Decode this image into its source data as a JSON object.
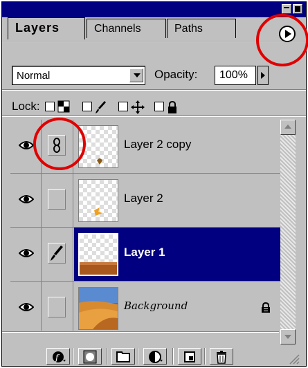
{
  "tabs": [
    {
      "label": "Layers",
      "active": true
    },
    {
      "label": "Channels",
      "active": false
    },
    {
      "label": "Paths",
      "active": false
    }
  ],
  "blend_mode": "Normal",
  "opacity": {
    "label": "Opacity:",
    "value": "100%"
  },
  "lock": {
    "label": "Lock:",
    "options": [
      "transparency-lock",
      "image-lock",
      "position-lock",
      "all-lock"
    ]
  },
  "layers": [
    {
      "name": "Layer 2 copy",
      "visible": true,
      "linked": true,
      "selected": false
    },
    {
      "name": "Layer 2",
      "visible": true,
      "linked": false,
      "selected": false
    },
    {
      "name": "Layer 1",
      "visible": true,
      "brush": true,
      "selected": true
    },
    {
      "name": "Background",
      "visible": true,
      "linked": false,
      "selected": false,
      "locked": true
    }
  ],
  "bottom_buttons": [
    "layer-style",
    "layer-mask",
    "new-layer-set",
    "adjustment-layer",
    "new-layer",
    "delete-layer"
  ],
  "colors": {
    "title_bar": "#000080",
    "selection": "#000080",
    "panel": "#c0c0c0",
    "annotation": "#e00000"
  }
}
